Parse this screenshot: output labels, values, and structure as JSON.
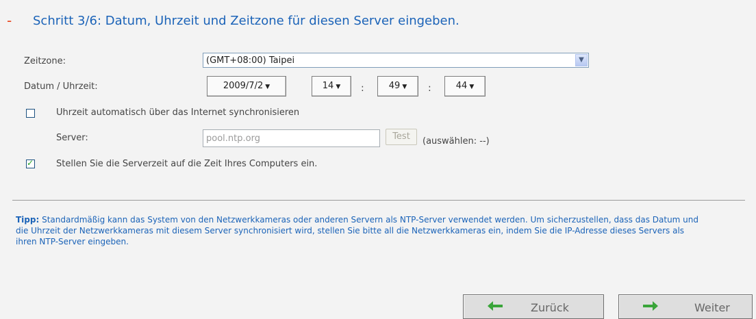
{
  "step": {
    "dash": "-",
    "title": "Schritt 3/6: Datum, Uhrzeit und Zeitzone für diesen Server eingeben."
  },
  "timezone": {
    "label": "Zeitzone:",
    "value": "(GMT+08:00) Taipei"
  },
  "datetime": {
    "label": "Datum / Uhrzeit:",
    "date": "2009/7/2",
    "hour": "14",
    "minute": "49",
    "second": "44",
    "separator": ":"
  },
  "ntp": {
    "checkbox_label": "Uhrzeit automatisch über das Internet synchronisieren",
    "checked": false,
    "server_label": "Server:",
    "server_value": "pool.ntp.org",
    "test_label": "Test",
    "select_hint": "(auswählen: --)"
  },
  "sync_computer": {
    "checkbox_label": "Stellen Sie die Serverzeit auf die Zeit Ihres Computers ein.",
    "checked": true
  },
  "tip": {
    "prefix": "Tipp:",
    "text": " Standardmäßig kann das System von den Netzwerkkameras oder anderen Servern als NTP-Server verwendet werden. Um sicherzustellen, dass das Datum und die Uhrzeit der Netzwerkkameras mit diesem Server synchronisiert wird, stellen Sie bitte all die Netzwerkkameras ein, indem Sie die IP-Adresse dieses Servers als ihren NTP-Server eingeben."
  },
  "nav": {
    "back_label": "Zurück",
    "next_label": "Weiter",
    "arrow_color": "#3aa53a"
  }
}
